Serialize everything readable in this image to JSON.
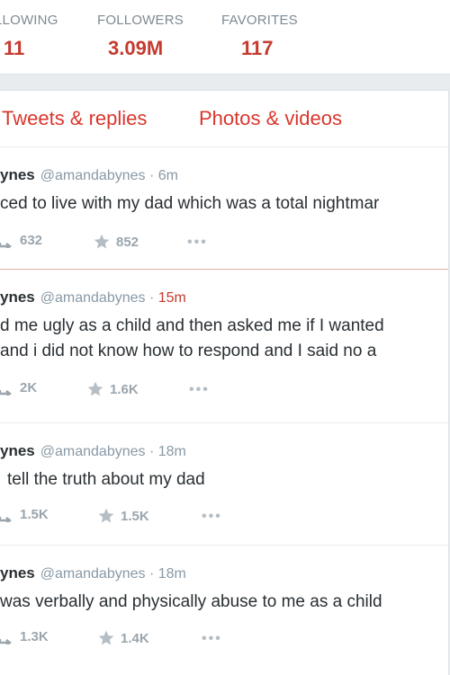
{
  "stats": [
    {
      "label": "LLOWING",
      "value": "11"
    },
    {
      "label": "FOLLOWERS",
      "value": "3.09M"
    },
    {
      "label": "FAVORITES",
      "value": "117"
    }
  ],
  "tabs": [
    {
      "label": "Tweets & replies"
    },
    {
      "label": "Photos & videos"
    }
  ],
  "tweets": [
    {
      "name": "ynes",
      "handle": "@amandabynes",
      "time": "6m",
      "lines": [
        "ced to live with my dad which was a total nightmar"
      ],
      "retweets": "632",
      "favorites": "852",
      "more": "•••"
    },
    {
      "name": "ynes",
      "handle": "@amandabynes",
      "time": "15m",
      "lines": [
        "d me ugly as a child and then asked me if I wanted",
        "and i did not know how to respond and I said no a"
      ],
      "retweets": "2K",
      "favorites": "1.6K",
      "more": "•••"
    },
    {
      "name": "ynes",
      "handle": "@amandabynes",
      "time": "18m",
      "lines": [
        "tell the truth about my dad"
      ],
      "retweets": "1.5K",
      "favorites": "1.5K",
      "more": "•••"
    },
    {
      "name": "ynes",
      "handle": "@amandabynes",
      "time": "18m",
      "lines": [
        "was verbally and physically abuse to me as a child"
      ],
      "retweets": "1.3K",
      "favorites": "1.4K",
      "more": "•••"
    }
  ],
  "colors": {
    "accent": "#d9362c",
    "stat_value": "#c53a2e",
    "muted": "#8899a6"
  }
}
